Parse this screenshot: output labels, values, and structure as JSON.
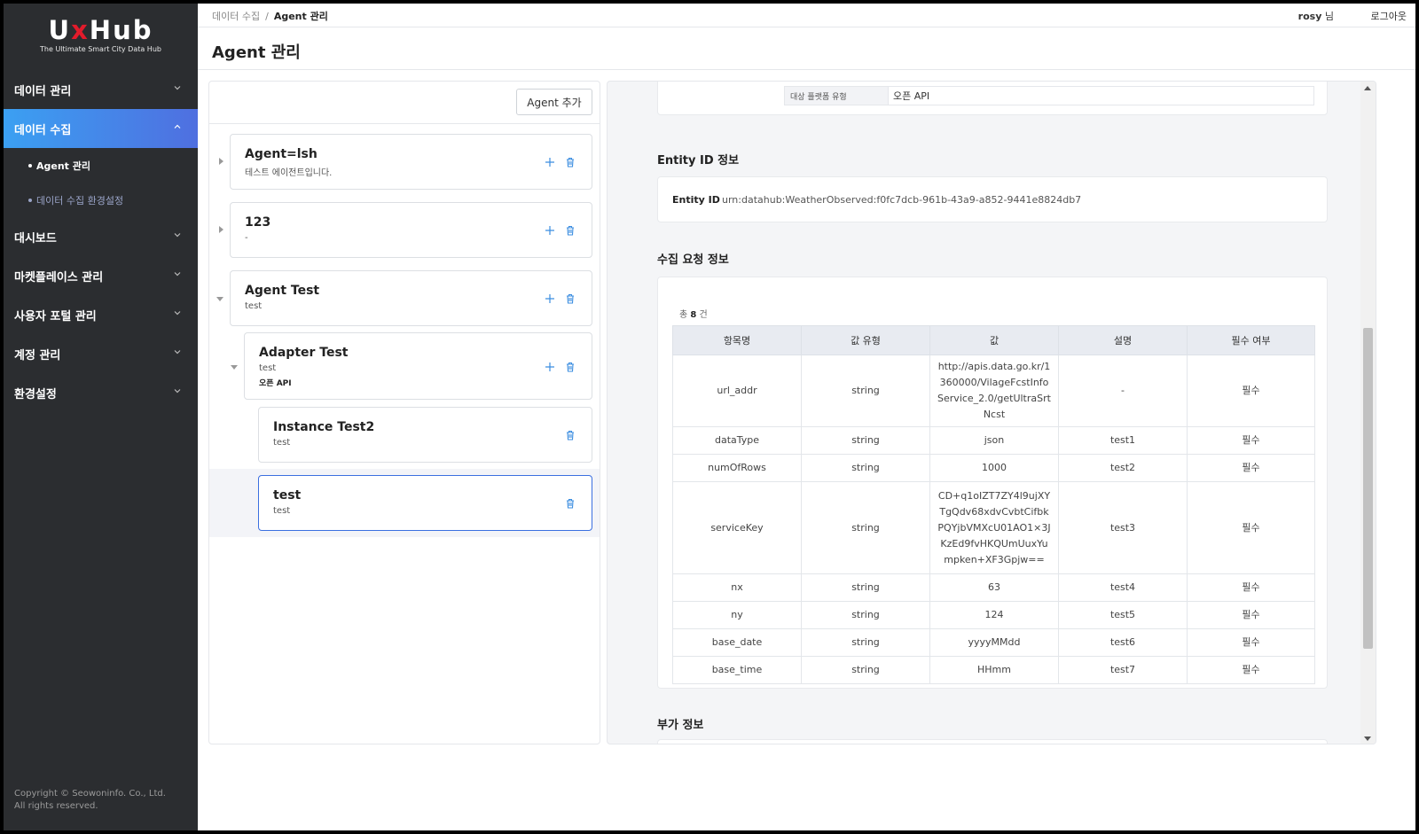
{
  "brand": {
    "logo_text": "UxHub",
    "tagline": "The Ultimate Smart City Data Hub",
    "accent": "#e21b2b"
  },
  "sidebar": {
    "items": [
      {
        "label": "데이터 관리"
      },
      {
        "label": "데이터 수집",
        "active": true,
        "children": [
          {
            "label": "Agent 관리",
            "active": true
          },
          {
            "label": "데이터 수집 환경설정"
          }
        ]
      },
      {
        "label": "대시보드"
      },
      {
        "label": "마켓플레이스 관리"
      },
      {
        "label": "사용자 포털 관리"
      },
      {
        "label": "계정 관리"
      },
      {
        "label": "환경설정"
      }
    ],
    "copyright_line1": "Copyright © Seowoninfo. Co., Ltd.",
    "copyright_line2": "All rights reserved."
  },
  "header": {
    "breadcrumb": [
      "데이터 수집",
      "Agent 관리"
    ],
    "breadcrumb_sep": "/",
    "user_name": "rosy",
    "user_suffix": " 님",
    "logout": "로그아웃",
    "page_title": "Agent 관리"
  },
  "tree": {
    "add_button": "Agent 추가",
    "nodes": [
      {
        "title": "Agent=lsh",
        "desc": "테스트 에이전트입니다."
      },
      {
        "title": "123",
        "desc": "-"
      },
      {
        "title": "Agent Test",
        "desc": "test"
      },
      {
        "title": "Adapter Test",
        "desc": "test",
        "platform": "오픈 API"
      },
      {
        "title": "Instance Test2",
        "desc": "test"
      },
      {
        "title": "test",
        "desc": "test",
        "selected": true
      }
    ]
  },
  "detail": {
    "platform_label": "대상 플랫폼 유형",
    "platform_value": "오픈 API",
    "entity_section_title": "Entity ID 정보",
    "entity_label": "Entity ID",
    "entity_value": "urn:datahub:WeatherObserved:f0fc7dcb-961b-43a9-a852-9441e8824db7",
    "request_section_title": "수집 요청 정보",
    "total_prefix": "총 ",
    "total_count": "8",
    "total_suffix": " 건",
    "columns": [
      "항목명",
      "값 유형",
      "값",
      "설명",
      "필수 여부"
    ],
    "rows": [
      [
        "url_addr",
        "string",
        "http://apis.data.go.kr/1360000/VilageFcstInfoService_2.0/getUltraSrtNcst",
        "-",
        "필수"
      ],
      [
        "dataType",
        "string",
        "json",
        "test1",
        "필수"
      ],
      [
        "numOfRows",
        "string",
        "1000",
        "test2",
        "필수"
      ],
      [
        "serviceKey",
        "string",
        "CD+q1oIZT7ZY4l9ujXYTgQdv68xdvCvbtCifbkPQYjbVMXcU01AO1×3JKzEd9fvHKQUmUuxYumpken+XF3Gpjw==",
        "test3",
        "필수"
      ],
      [
        "nx",
        "string",
        "63",
        "test4",
        "필수"
      ],
      [
        "ny",
        "string",
        "124",
        "test5",
        "필수"
      ],
      [
        "base_date",
        "string",
        "yyyyMMdd",
        "test6",
        "필수"
      ],
      [
        "base_time",
        "string",
        "HHmm",
        "test7",
        "필수"
      ]
    ],
    "extra_section_title": "부가 정보"
  },
  "icons": {
    "plus": "plus-icon",
    "trash": "trash-icon",
    "chevron": "chevron-down-icon",
    "caret": "caret-icon"
  },
  "colors": {
    "active_menu": "#3ba0f2",
    "icon_blue": "#3b8de0",
    "selected_border": "#3b6fe0"
  }
}
